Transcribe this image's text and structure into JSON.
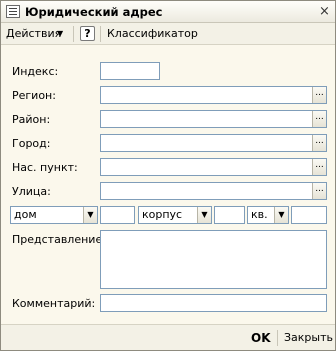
{
  "window": {
    "title": "Юридический адрес",
    "close_glyph": "×"
  },
  "toolbar": {
    "actions_label": "Действия",
    "actions_arrow": "▼",
    "help_label": "?",
    "classifier_label": "Классификатор"
  },
  "form": {
    "index": {
      "label": "Индекс:",
      "value": ""
    },
    "region": {
      "label": "Регион:",
      "value": ""
    },
    "district": {
      "label": "Район:",
      "value": ""
    },
    "city": {
      "label": "Город:",
      "value": ""
    },
    "locality": {
      "label": "Нас. пункт:",
      "value": ""
    },
    "street": {
      "label": "Улица:",
      "value": ""
    },
    "house_type": {
      "selected": "дом",
      "value": ""
    },
    "building_type": {
      "selected": "корпус",
      "value": ""
    },
    "apartment_type": {
      "selected": "кв.",
      "value": ""
    },
    "presentation": {
      "label": "Представление:",
      "value": ""
    },
    "comment": {
      "label": "Комментарий:",
      "value": ""
    },
    "ellipsis_glyph": "...",
    "dropdown_glyph": "▼"
  },
  "footer": {
    "ok_label": "OK",
    "close_label": "Закрыть"
  }
}
